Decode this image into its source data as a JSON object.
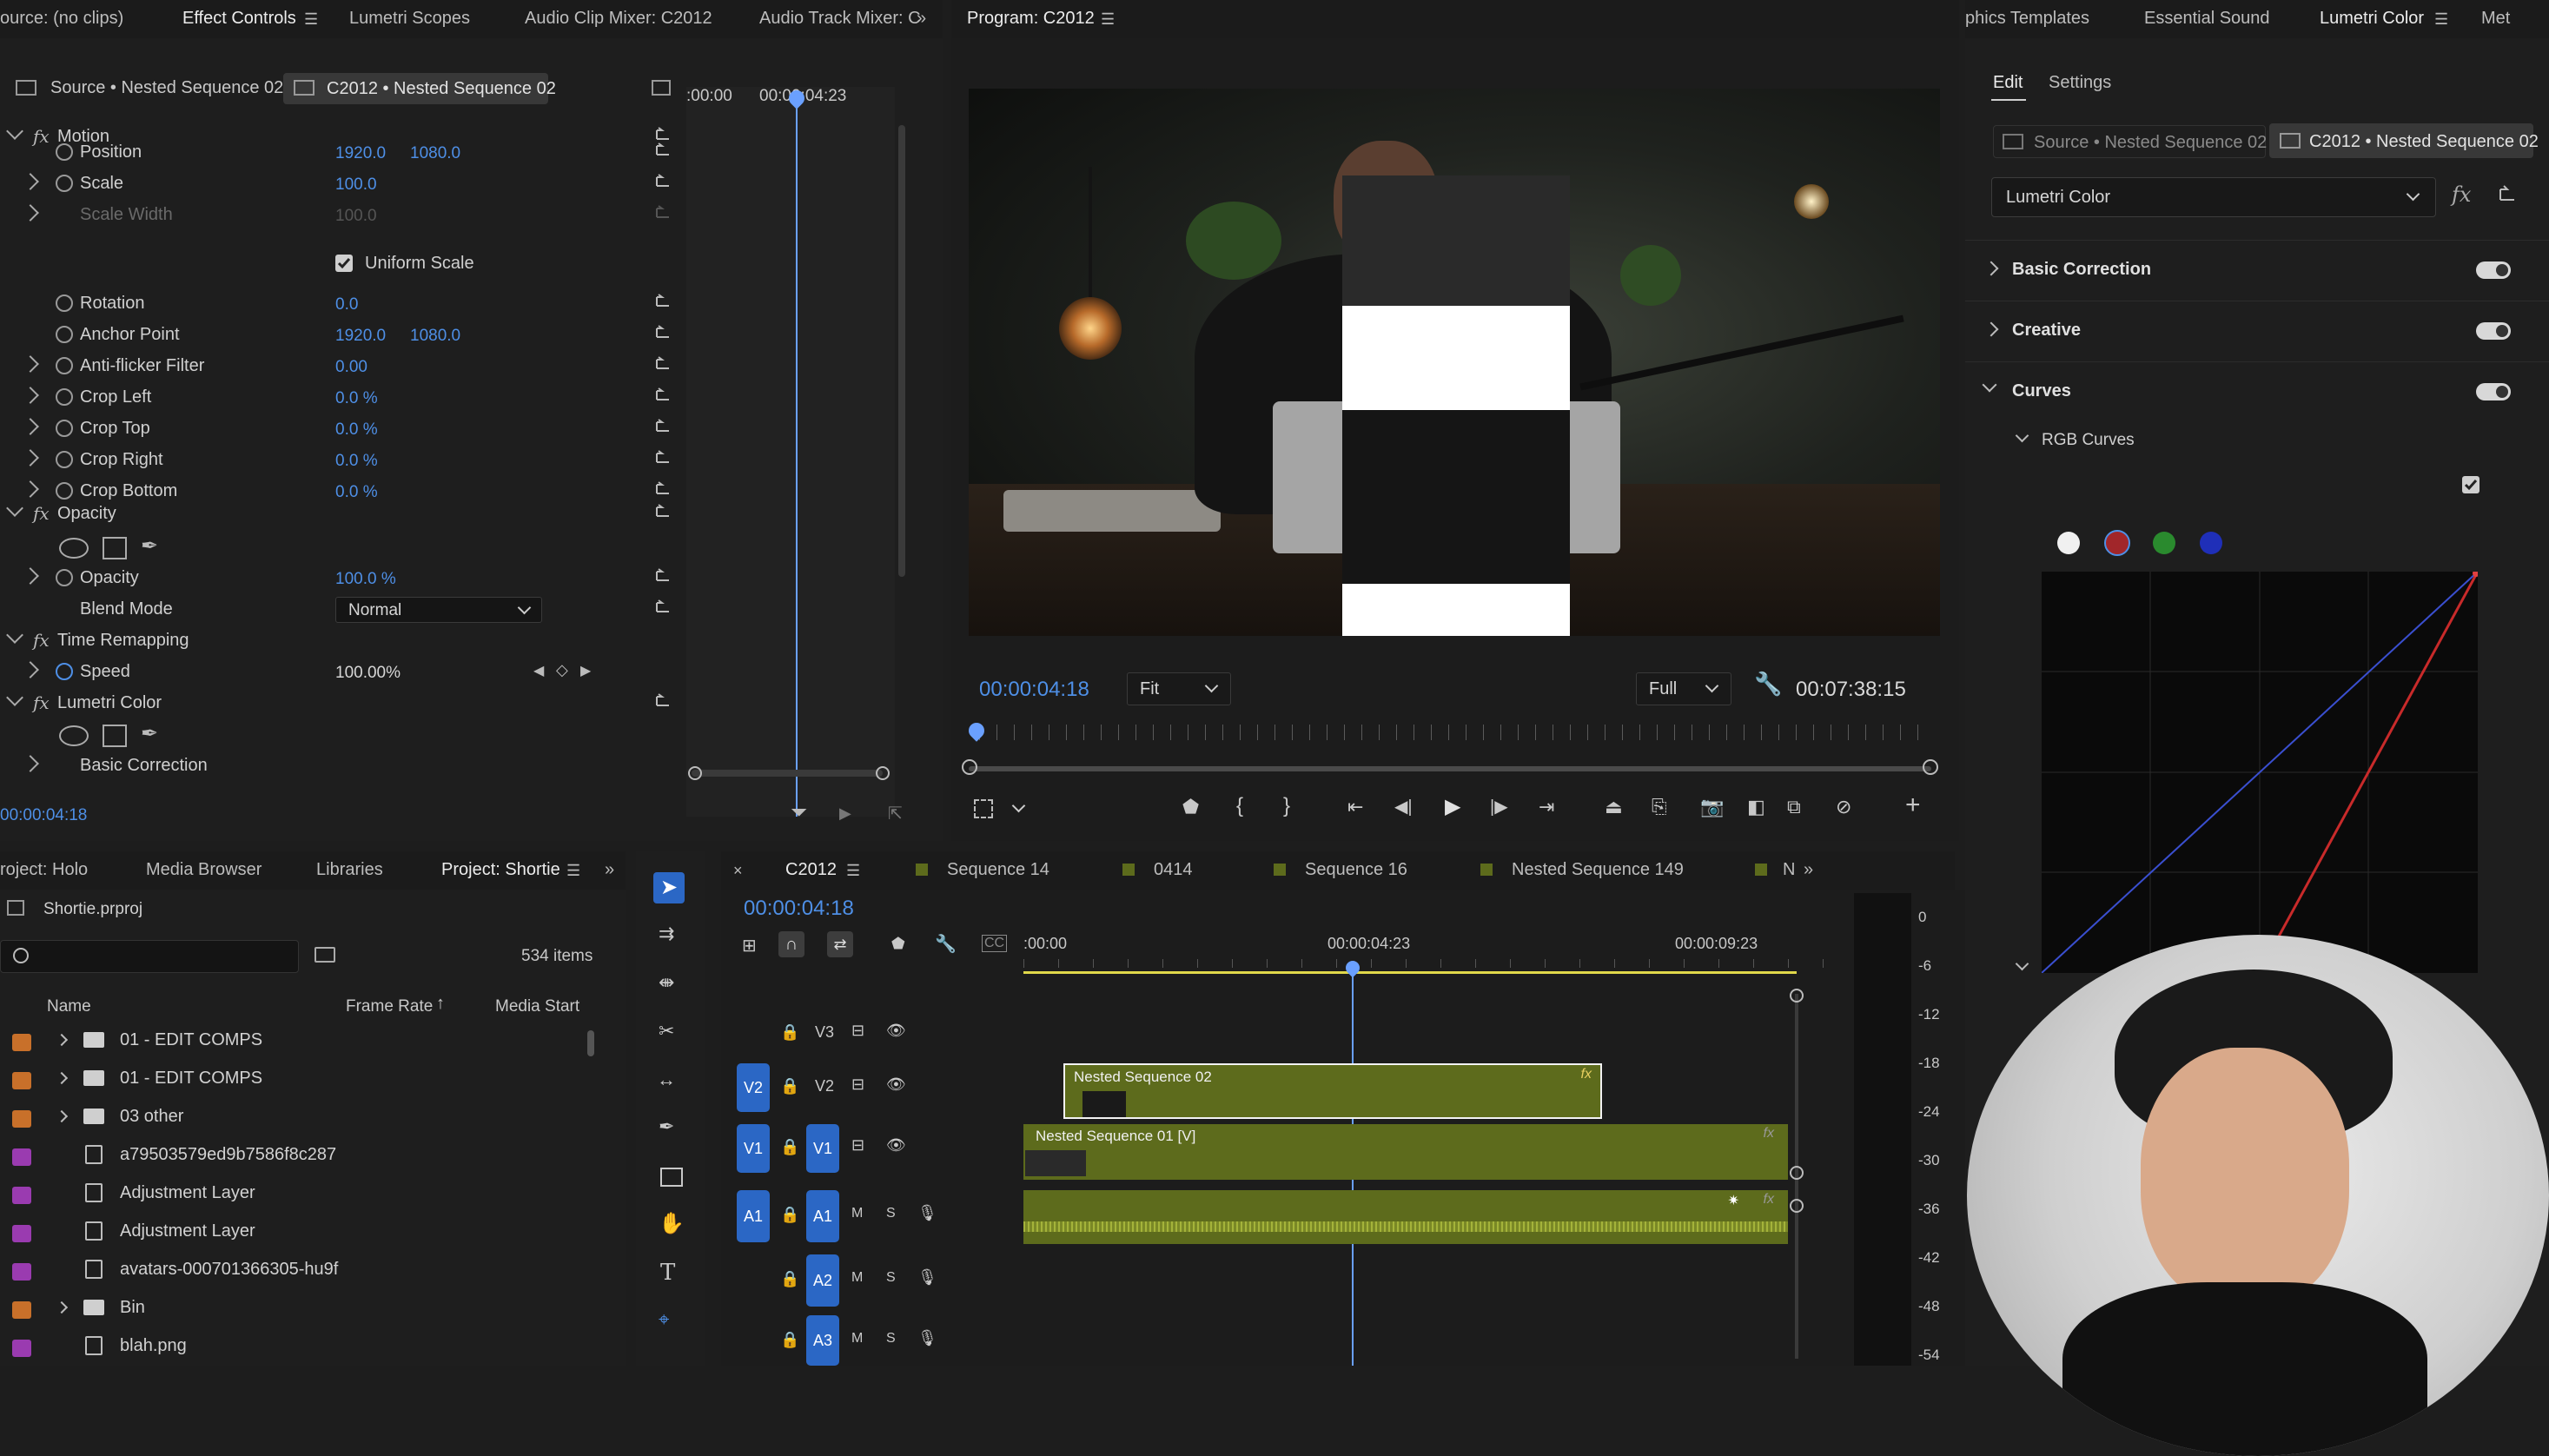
{
  "top_tabs": {
    "source": "ource: (no clips)",
    "effect_controls": "Effect Controls",
    "lumetri_scopes": "Lumetri Scopes",
    "audio_clip_mixer": "Audio Clip Mixer: C2012",
    "audio_track_mixer": "Audio Track Mixer: C",
    "program": "Program: C2012",
    "graphics_templates": "phics Templates",
    "essential_sound": "Essential Sound",
    "lumetri_color": "Lumetri Color",
    "meta": "Met"
  },
  "effect_controls": {
    "source_tab": "Source • Nested Sequence 02",
    "clip_tab": "C2012 • Nested Sequence 02",
    "ruler_start": ":00:00",
    "ruler_mid": "00:00:04:23",
    "timecode": "00:00:04:18",
    "motion": "Motion",
    "props": [
      {
        "label": "Position",
        "v1": "1920.0",
        "v2": "1080.0"
      },
      {
        "label": "Scale",
        "v1": "100.0",
        "v2": ""
      },
      {
        "label": "Scale Width",
        "v1": "100.0",
        "v2": ""
      },
      {
        "label": "Rotation",
        "v1": "0.0",
        "v2": ""
      },
      {
        "label": "Anchor Point",
        "v1": "1920.0",
        "v2": "1080.0"
      },
      {
        "label": "Anti-flicker Filter",
        "v1": "0.00",
        "v2": ""
      },
      {
        "label": "Crop Left",
        "v1": "0.0 %",
        "v2": ""
      },
      {
        "label": "Crop Top",
        "v1": "0.0 %",
        "v2": ""
      },
      {
        "label": "Crop Right",
        "v1": "0.0 %",
        "v2": ""
      },
      {
        "label": "Crop Bottom",
        "v1": "0.0 %",
        "v2": ""
      }
    ],
    "uniform_scale": "Uniform Scale",
    "opacity_section": "Opacity",
    "opacity_label": "Opacity",
    "opacity_value": "100.0 %",
    "blend_mode_label": "Blend Mode",
    "blend_mode_value": "Normal",
    "time_remapping": "Time Remapping",
    "speed_label": "Speed",
    "speed_value": "100.00%",
    "lumetri_section": "Lumetri Color",
    "basic_correction": "Basic Correction"
  },
  "program": {
    "timecode": "00:00:04:18",
    "fit": "Fit",
    "quality": "Full",
    "duration": "00:07:38:15"
  },
  "lumetri": {
    "edit_tab": "Edit",
    "settings_tab": "Settings",
    "source_tab": "Source • Nested Sequence 02",
    "clip_tab": "C2012 • Nested Sequence 02",
    "effect_select": "Lumetri Color",
    "basic_correction": "Basic Correction",
    "creative": "Creative",
    "curves": "Curves",
    "rgb_curves": "RGB Curves"
  },
  "project": {
    "tabs": [
      "roject: Holo",
      "Media Browser",
      "Libraries",
      "Project: Shortie"
    ],
    "file": "Shortie.prproj",
    "items_count": "534 items",
    "col_name": "Name",
    "col_frame_rate": "Frame Rate",
    "col_media_start": "Media Start",
    "rows": [
      {
        "name": "01 - EDIT COMPS",
        "kind": "folder",
        "color": "#c8702a"
      },
      {
        "name": "01 - EDIT COMPS",
        "kind": "folder",
        "color": "#c8702a"
      },
      {
        "name": "03 other",
        "kind": "folder",
        "color": "#c8702a"
      },
      {
        "name": "a79503579ed9b7586f8c287",
        "kind": "file",
        "color": "#9a3bb0"
      },
      {
        "name": "Adjustment Layer",
        "kind": "file",
        "color": "#9a3bb0"
      },
      {
        "name": "Adjustment Layer",
        "kind": "file",
        "color": "#9a3bb0"
      },
      {
        "name": "avatars-000701366305-hu9f",
        "kind": "file",
        "color": "#9a3bb0"
      },
      {
        "name": "Bin",
        "kind": "folder",
        "color": "#c8702a"
      },
      {
        "name": "blah.png",
        "kind": "file",
        "color": "#9a3bb0"
      }
    ]
  },
  "timeline": {
    "tabs": [
      "C2012",
      "Sequence 14",
      "0414",
      "Sequence 16",
      "Nested Sequence 149",
      "N"
    ],
    "timecode": "00:00:04:18",
    "ruler": [
      ":00:00",
      "00:00:04:23",
      "00:00:09:23"
    ],
    "tracks": {
      "v3": "V3",
      "v2": "V2",
      "v1": "V1",
      "a1": "A1",
      "a2": "A2",
      "a3": "A3",
      "m": "M",
      "s": "S"
    },
    "clip_v2": "Nested Sequence 02",
    "clip_v1": "Nested Sequence 01 [V]",
    "meter_labels": [
      "0",
      "-6",
      "-12",
      "-18",
      "-24",
      "-30",
      "-36",
      "-42",
      "-48",
      "-54"
    ]
  },
  "colors": {
    "accent": "#4e8fe6",
    "track_badge": "#2b67c5",
    "clip_green": "#5d6b1c",
    "playhead": "#6aa0ff",
    "work_area": "#e0d84a"
  }
}
